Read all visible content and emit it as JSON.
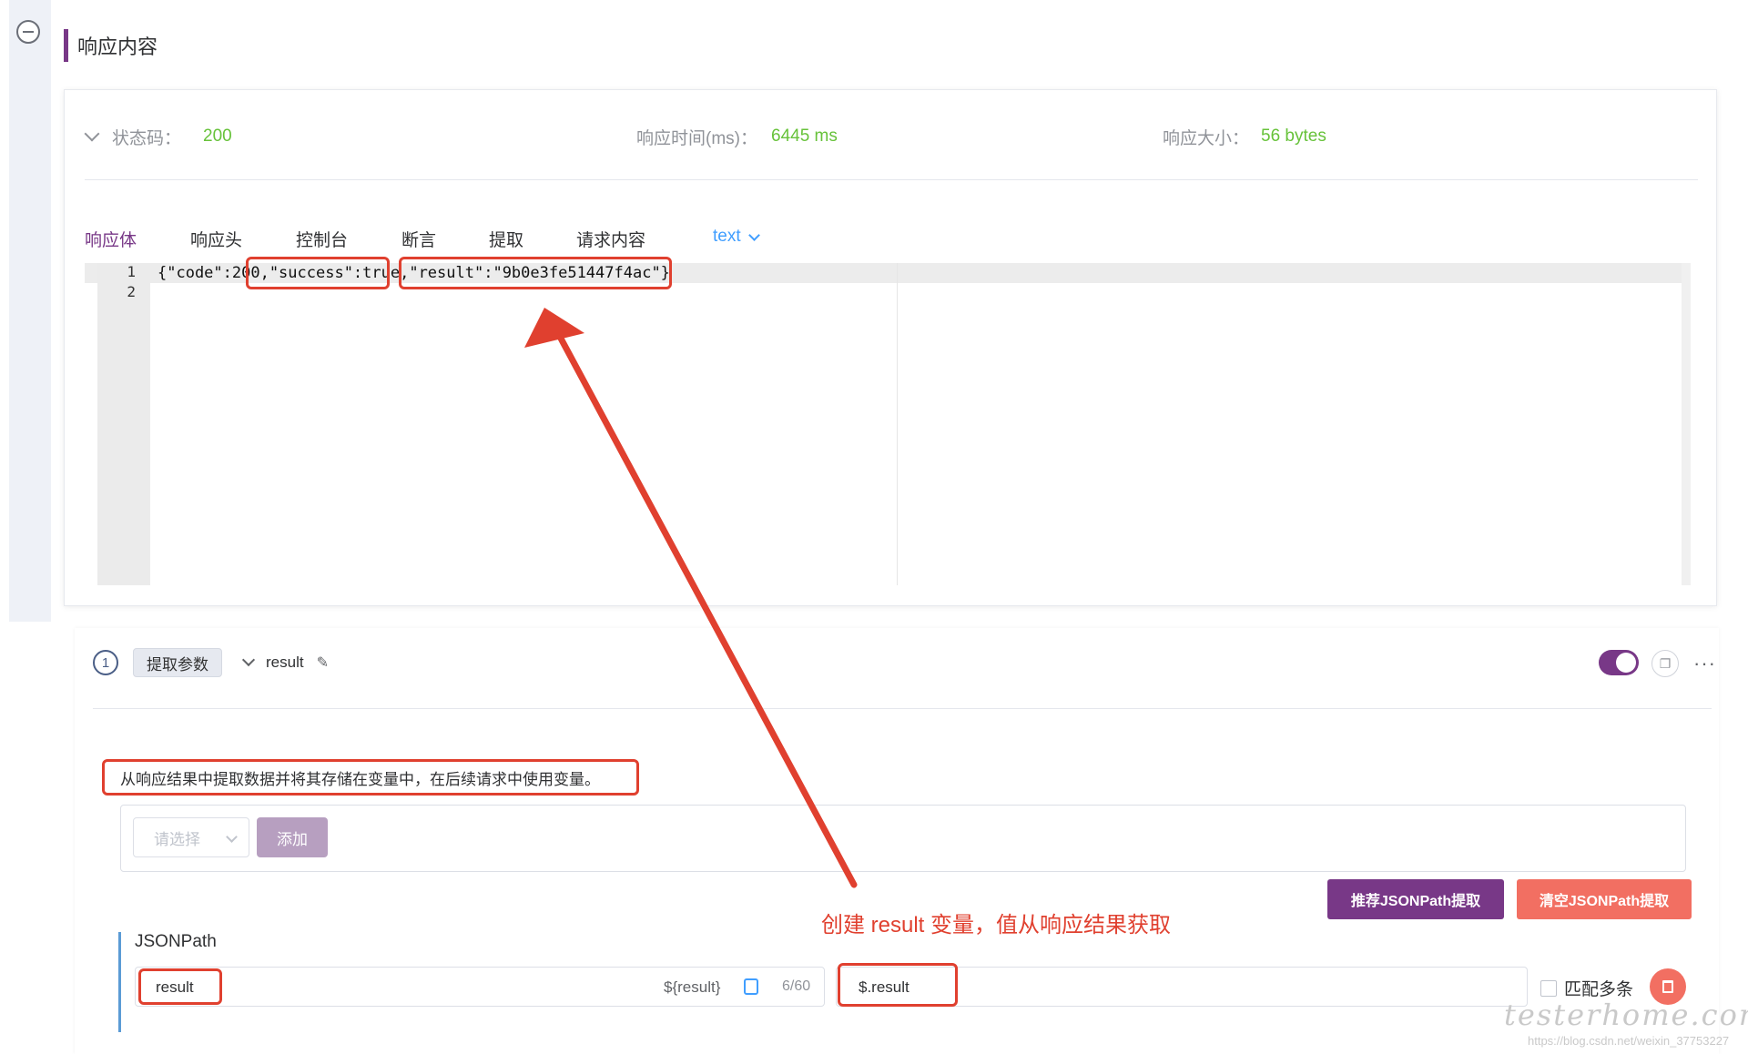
{
  "section": {
    "title": "响应内容"
  },
  "status": {
    "code_label": "状态码：",
    "code_value": "200",
    "time_label": "响应时间(ms)：",
    "time_value": "6445 ms",
    "size_label": "响应大小：",
    "size_value": "56 bytes"
  },
  "tabs": [
    {
      "label": "响应体",
      "active": true
    },
    {
      "label": "响应头"
    },
    {
      "label": "控制台"
    },
    {
      "label": "断言"
    },
    {
      "label": "提取"
    },
    {
      "label": "请求内容"
    }
  ],
  "format_mode": "text",
  "editor": {
    "lines": [
      "1",
      "2"
    ],
    "code_line_1": "{\"code\":200,\"success\":true,\"result\":\"9b0e3fe51447f4ac\"}"
  },
  "extract": {
    "index": "1",
    "type_tag": "提取参数",
    "name": "result",
    "enabled": true,
    "description": "从响应结果中提取数据并将其存储在变量中，在后续请求中使用变量。",
    "select_placeholder": "请选择",
    "add_label": "添加",
    "recommend_label": "推荐JSONPath提取",
    "clear_label": "清空JSONPath提取",
    "annotation": "创建 result 变量，值从响应结果获取",
    "jsonpath_label": "JSONPath",
    "var_name": "result",
    "var_ref": "${result}",
    "char_count": "6/60",
    "path_value": "$.result",
    "multi_label": "匹配多条"
  },
  "watermark": "testerhome.com",
  "source_url": "https://blog.csdn.net/weixin_37753227",
  "colors": {
    "primary": "#783887",
    "success": "#67c23a",
    "link": "#409eff",
    "danger": "#f26f62",
    "annotation": "#e0402f"
  }
}
